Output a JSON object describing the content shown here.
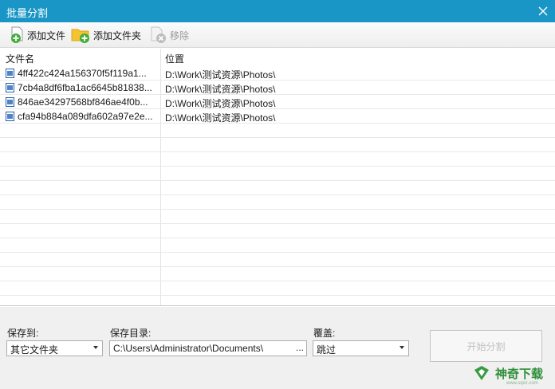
{
  "window": {
    "title": "批量分割"
  },
  "toolbar": {
    "add_file": "添加文件",
    "add_folder": "添加文件夹",
    "remove": "移除"
  },
  "list": {
    "columns": {
      "name": "文件名",
      "location": "位置"
    },
    "rows": [
      {
        "name": "4ff422c424a156370f5f119a1...",
        "location": "D:\\Work\\测试资源\\Photos\\"
      },
      {
        "name": "7cb4a8df6fba1ac6645b81838...",
        "location": "D:\\Work\\测试资源\\Photos\\"
      },
      {
        "name": "846ae34297568bf846ae4f0b...",
        "location": "D:\\Work\\测试资源\\Photos\\"
      },
      {
        "name": "cfa94b884a089dfa602a97e2e...",
        "location": "D:\\Work\\测试资源\\Photos\\"
      }
    ]
  },
  "bottom": {
    "save_to_label": "保存到:",
    "save_to_value": "其它文件夹",
    "save_dir_label": "保存目录:",
    "save_dir_value": "C:\\Users\\Administrator\\Documents\\",
    "browse": "...",
    "overwrite_label": "覆盖:",
    "overwrite_value": "跳过",
    "start_button": "开始分割"
  },
  "watermark": {
    "text": "神奇下载",
    "sub": "www.sqxz.com"
  },
  "colors": {
    "titlebar": "#1a96c6",
    "accent_green": "#2f8f3a"
  }
}
